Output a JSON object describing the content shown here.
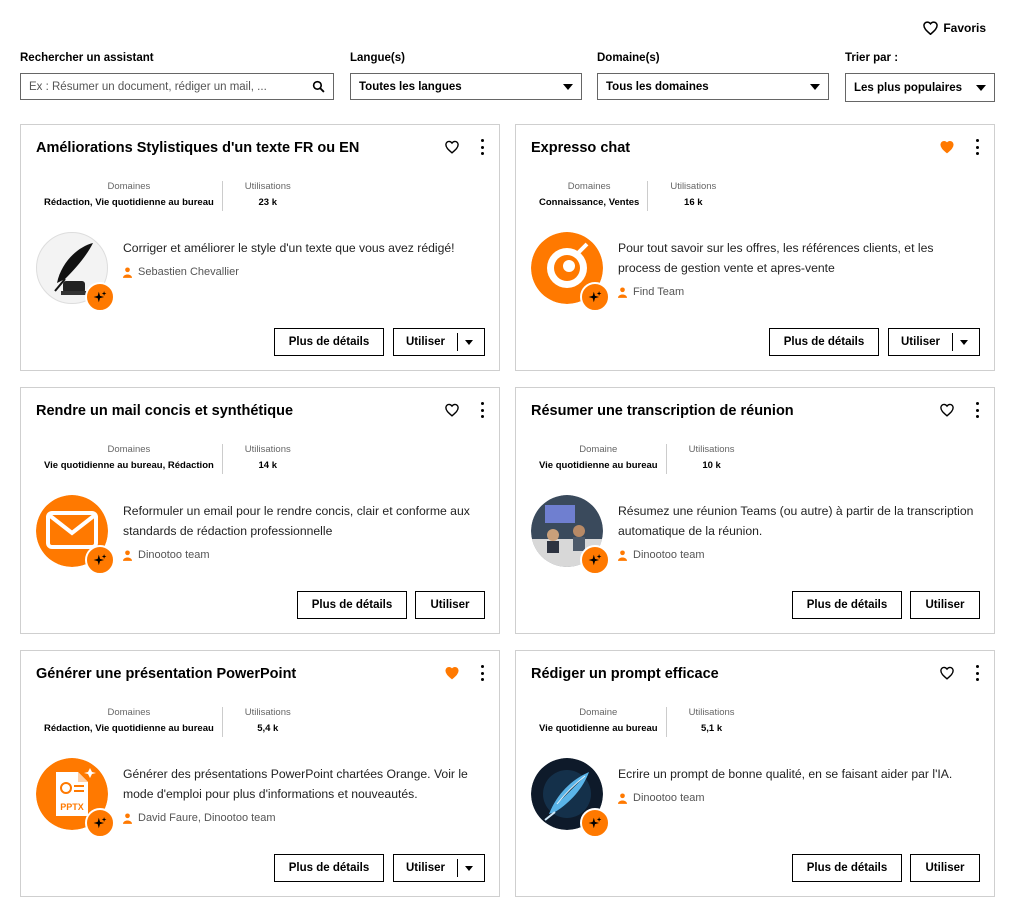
{
  "header": {
    "favorites_label": "Favoris"
  },
  "filters": {
    "search": {
      "label": "Rechercher un assistant",
      "placeholder": "Ex : Résumer un document, rédiger un mail, ..."
    },
    "language": {
      "label": "Langue(s)",
      "value": "Toutes les langues"
    },
    "domain": {
      "label": "Domaine(s)",
      "value": "Tous les domaines"
    },
    "sort": {
      "label": "Trier par :",
      "value": "Les plus populaires"
    }
  },
  "colors": {
    "accent": "#ff7900"
  },
  "details_label": "Plus de détails",
  "use_label": "Utiliser",
  "cards": [
    {
      "title": "Améliorations Stylistiques d'un texte FR ou EN",
      "favorited": false,
      "domains_key": "Domaines",
      "domains_value": "Rédaction, Vie quotidienne au bureau",
      "uses_key": "Utilisations",
      "uses_value": "23 k",
      "description": "Corriger et améliorer le style d'un texte que vous avez rédigé!",
      "author": "Sebastien Chevallier",
      "icon": "quill-inkwell-icon"
    },
    {
      "title": "Expresso chat",
      "favorited": true,
      "domains_key": "Domaines",
      "domains_value": "Connaissance, Ventes",
      "uses_key": "Utilisations",
      "uses_value": "16 k",
      "description": "Pour tout savoir sur les offres, les références clients, et les process de gestion vente et apres-vente",
      "author": "Find Team",
      "icon": "search-loupe-icon"
    },
    {
      "title": "Rendre un mail concis et synthétique",
      "favorited": false,
      "domains_key": "Domaines",
      "domains_value": "Vie quotidienne au bureau, Rédaction",
      "uses_key": "Utilisations",
      "uses_value": "14 k",
      "description": "Reformuler un email pour le rendre concis, clair et conforme aux standards de rédaction professionnelle",
      "author": "Dinootoo team",
      "icon": "envelope-icon"
    },
    {
      "title": "Résumer une transcription de réunion",
      "favorited": false,
      "domains_key": "Domaine",
      "domains_value": "Vie quotidienne au bureau",
      "uses_key": "Utilisations",
      "uses_value": "10 k",
      "description": "Résumez une réunion Teams (ou autre) à partir de la transcription automatique de la réunion.",
      "author": "Dinootoo team",
      "icon": "meeting-photo-icon"
    },
    {
      "title": "Générer une présentation PowerPoint",
      "favorited": true,
      "domains_key": "Domaines",
      "domains_value": "Rédaction, Vie quotidienne au bureau",
      "uses_key": "Utilisations",
      "uses_value": "5,4 k",
      "description": "Générer des présentations PowerPoint chartées Orange. Voir le mode d'emploi pour plus d'informations et nouveautés.",
      "author": "David Faure, Dinootoo team",
      "icon": "pptx-file-icon",
      "pptx_text": "PPTX"
    },
    {
      "title": "Rédiger un prompt efficace",
      "favorited": false,
      "domains_key": "Domaine",
      "domains_value": "Vie quotidienne au bureau",
      "uses_key": "Utilisations",
      "uses_value": "5,1 k",
      "description": "Ecrire un prompt de bonne qualité, en se faisant aider par l'IA.",
      "author": "Dinootoo team",
      "icon": "feather-pen-icon"
    }
  ]
}
